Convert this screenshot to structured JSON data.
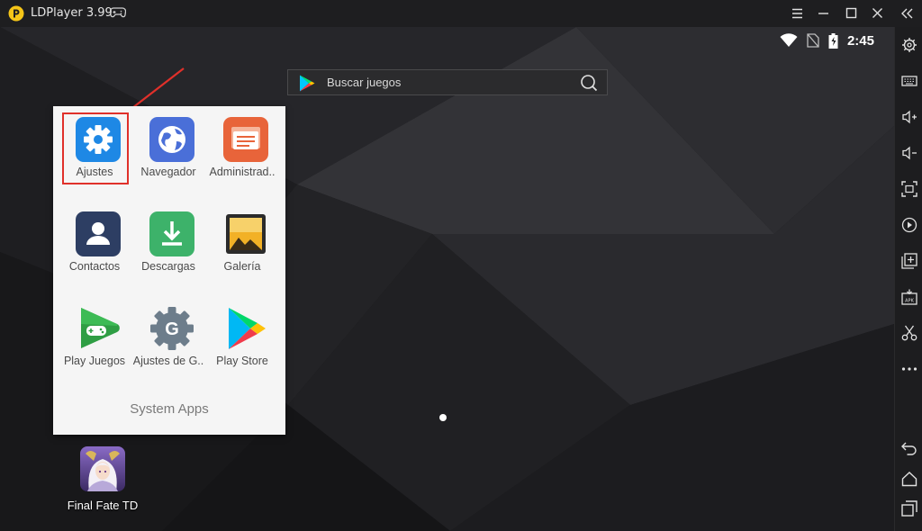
{
  "window": {
    "title": "LDPlayer 3.99",
    "controls": [
      "menu-icon",
      "minimize-icon",
      "maximize-icon",
      "close-icon",
      "collapse-sidebar-icon"
    ]
  },
  "statusbar": {
    "time": "2:45",
    "icons": [
      "wifi-icon",
      "no-sim-icon",
      "battery-charging-icon"
    ]
  },
  "search": {
    "placeholder": "Buscar juegos"
  },
  "folder": {
    "name": "System Apps",
    "apps": [
      {
        "label": "Ajustes",
        "icon": "settings-gear-icon",
        "highlighted": true
      },
      {
        "label": "Navegador",
        "icon": "browser-globe-icon"
      },
      {
        "label": "Administrad..",
        "icon": "file-manager-icon"
      },
      {
        "label": "Contactos",
        "icon": "contacts-icon"
      },
      {
        "label": "Descargas",
        "icon": "downloads-icon"
      },
      {
        "label": "Galería",
        "icon": "gallery-icon"
      },
      {
        "label": "Play Juegos",
        "icon": "play-games-icon"
      },
      {
        "label": "Ajustes de G..",
        "icon": "google-settings-icon"
      },
      {
        "label": "Play Store",
        "icon": "play-store-icon"
      }
    ]
  },
  "desktop": {
    "apps": [
      {
        "label": "Final Fate TD",
        "icon": "final-fate-td-icon"
      }
    ]
  },
  "sidebar": {
    "tools": [
      "settings-icon",
      "keyboard-icon",
      "volume-up-icon",
      "volume-down-icon",
      "fullscreen-icon",
      "record-icon",
      "add-window-icon",
      "apk-install-icon",
      "scissors-icon",
      "more-icon",
      "back-icon",
      "home-icon",
      "recent-apps-icon"
    ]
  },
  "colors": {
    "accent_highlight": "#e0302a",
    "titlebar": "#1e1e20",
    "folder_bg": "#f5f5f5"
  }
}
